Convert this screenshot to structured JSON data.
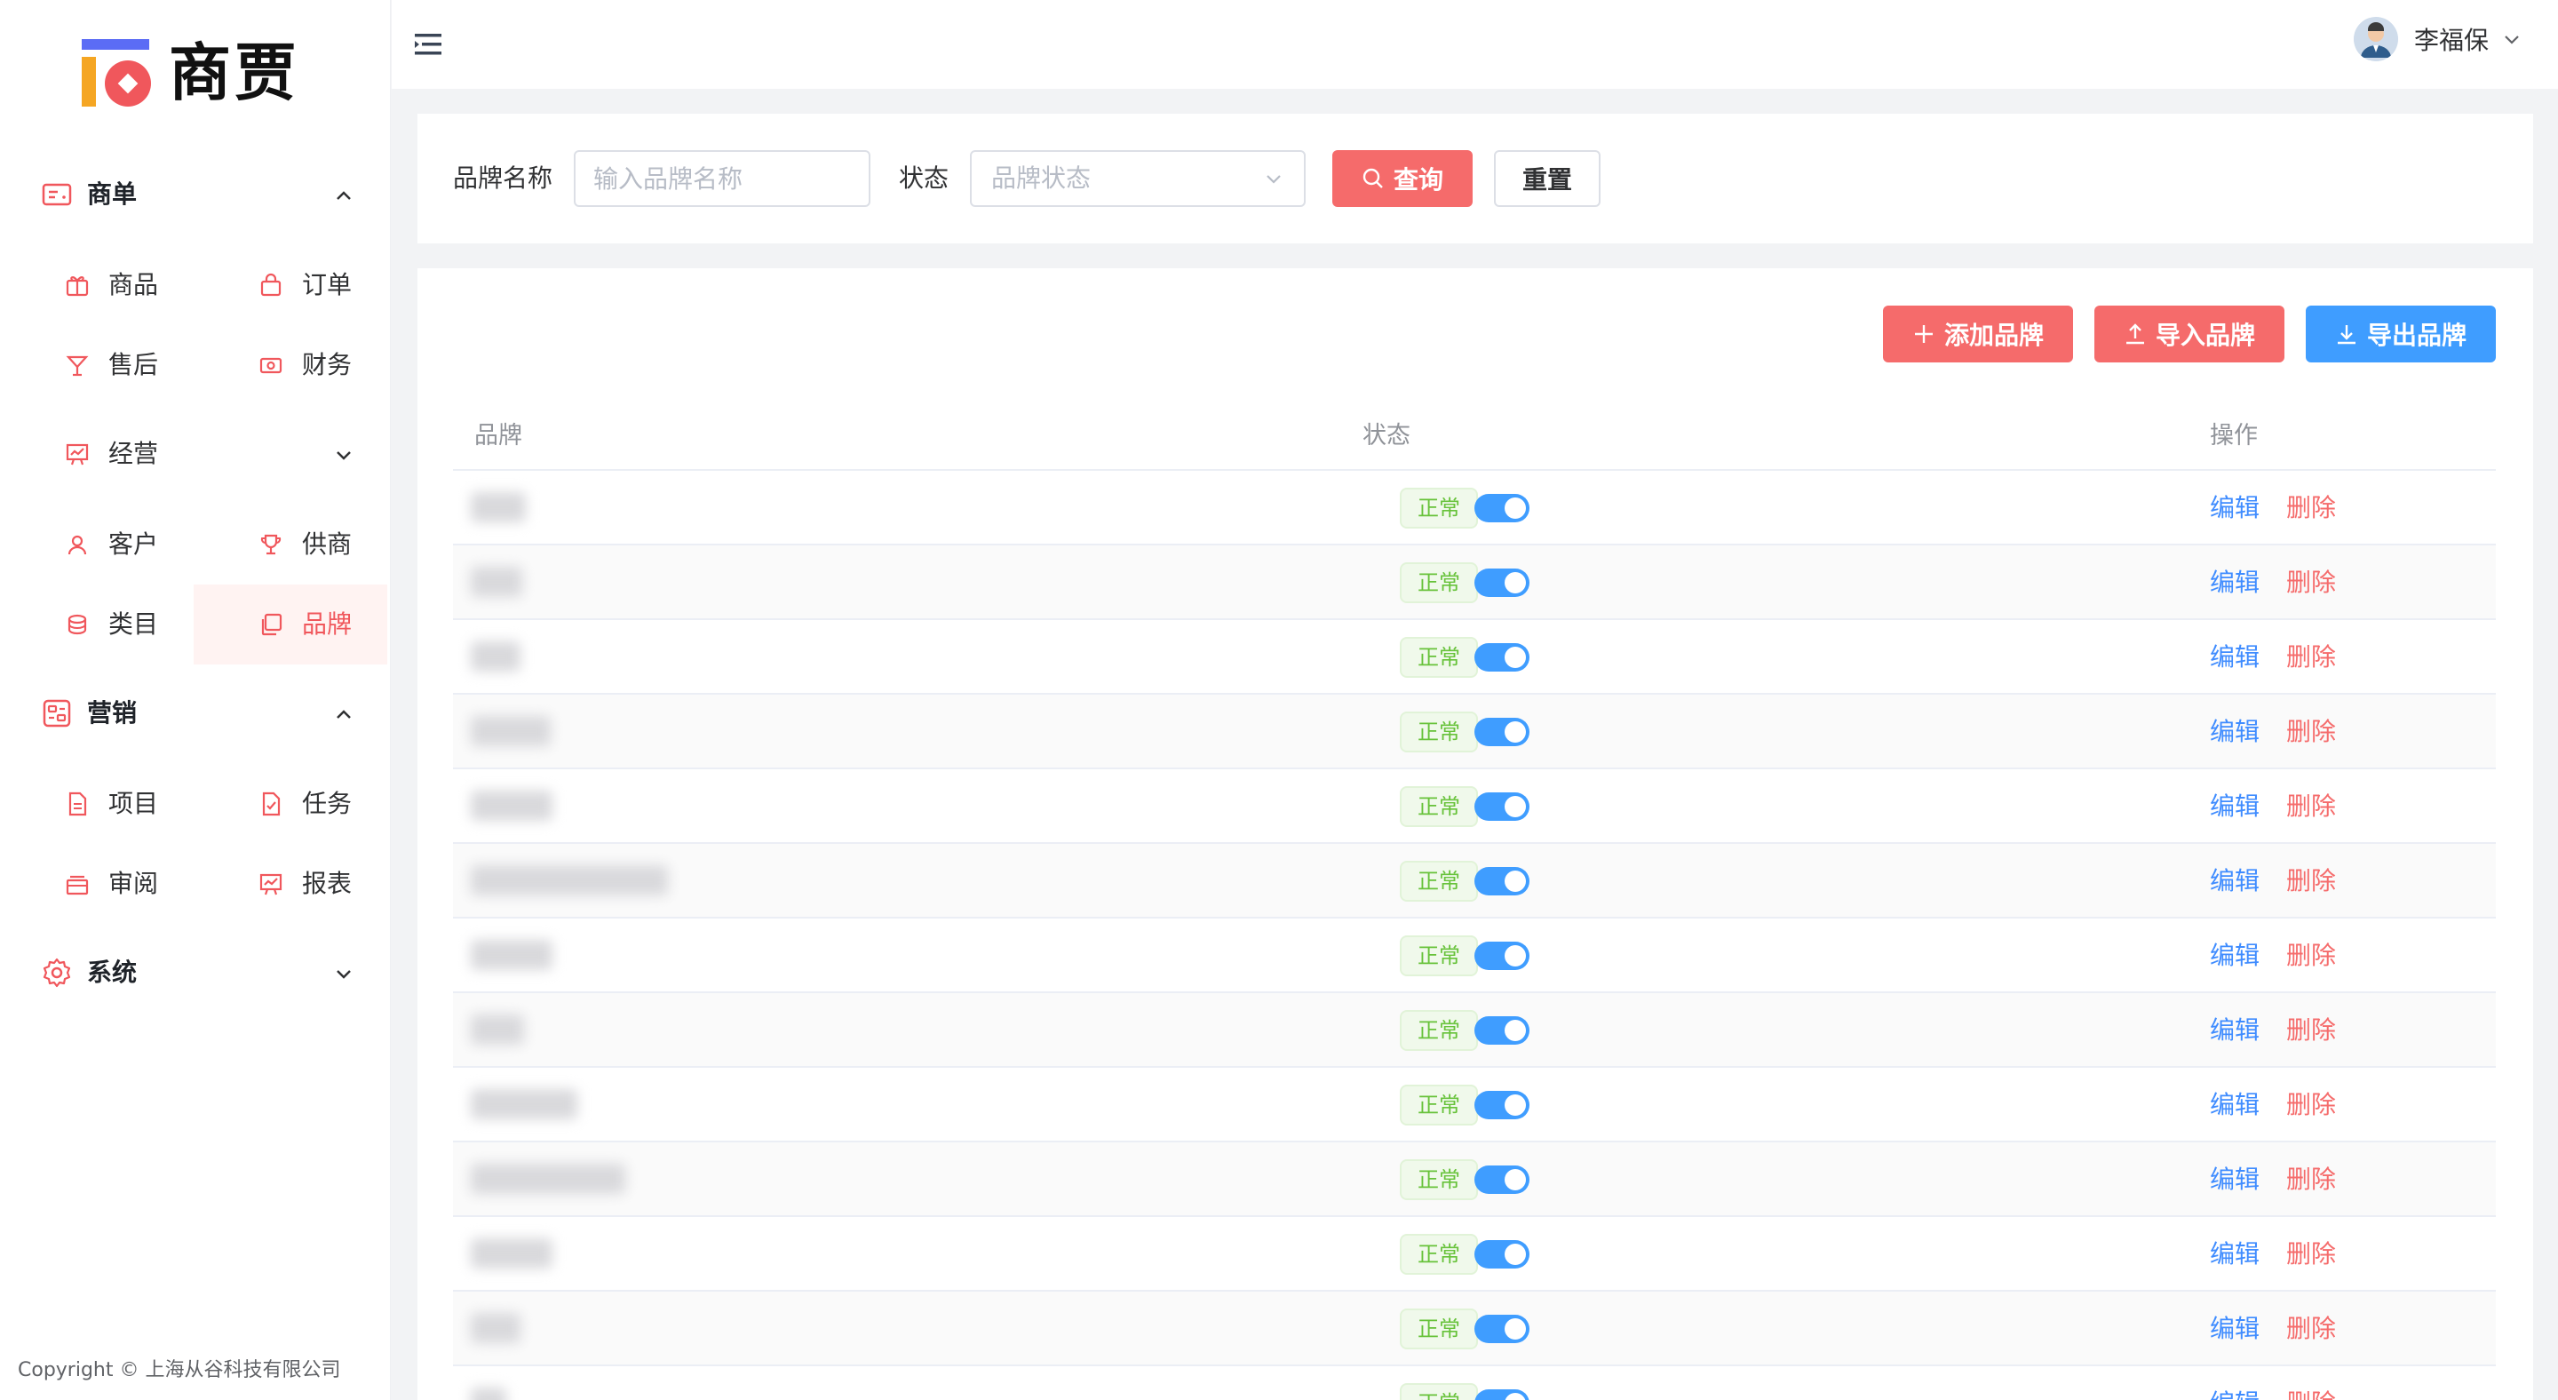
{
  "brand": {
    "logo_text": "商贾"
  },
  "sidebar": {
    "groups": [
      {
        "label": "商单"
      },
      {
        "label": "经营"
      },
      {
        "label": "营销"
      },
      {
        "label": "系统"
      }
    ],
    "items": [
      {
        "label": "商品"
      },
      {
        "label": "订单"
      },
      {
        "label": "售后"
      },
      {
        "label": "财务"
      },
      {
        "label": "客户"
      },
      {
        "label": "供商"
      },
      {
        "label": "类目"
      },
      {
        "label": "品牌"
      },
      {
        "label": "项目"
      },
      {
        "label": "任务"
      },
      {
        "label": "审阅"
      },
      {
        "label": "报表"
      }
    ],
    "active_item": "品牌",
    "copyright": "Copyright © 上海从谷科技有限公司"
  },
  "header": {
    "user_name": "李福保"
  },
  "search": {
    "brand_label": "品牌名称",
    "brand_placeholder": "输入品牌名称",
    "status_label": "状态",
    "status_placeholder": "品牌状态",
    "query_label": "查询",
    "reset_label": "重置"
  },
  "toolbar": {
    "add_label": "添加品牌",
    "import_label": "导入品牌",
    "export_label": "导出品牌"
  },
  "table": {
    "columns": [
      "品牌",
      "状态",
      "操作"
    ],
    "rows": [
      {
        "status": "正常",
        "enabled": true
      },
      {
        "status": "正常",
        "enabled": true
      },
      {
        "status": "正常",
        "enabled": true
      },
      {
        "status": "正常",
        "enabled": true
      },
      {
        "status": "正常",
        "enabled": true
      },
      {
        "status": "正常",
        "enabled": true
      },
      {
        "status": "正常",
        "enabled": true
      },
      {
        "status": "正常",
        "enabled": true
      },
      {
        "status": "正常",
        "enabled": true
      },
      {
        "status": "正常",
        "enabled": true
      },
      {
        "status": "正常",
        "enabled": true
      },
      {
        "status": "正常",
        "enabled": true
      },
      {
        "status": "正常",
        "enabled": true
      }
    ],
    "edit_label": "编辑",
    "delete_label": "删除"
  },
  "colors": {
    "accent": "#f56b6b",
    "blue": "#3f9dff",
    "success": "#67c23a",
    "link": "#3f8cff",
    "danger": "#f56c6c"
  }
}
